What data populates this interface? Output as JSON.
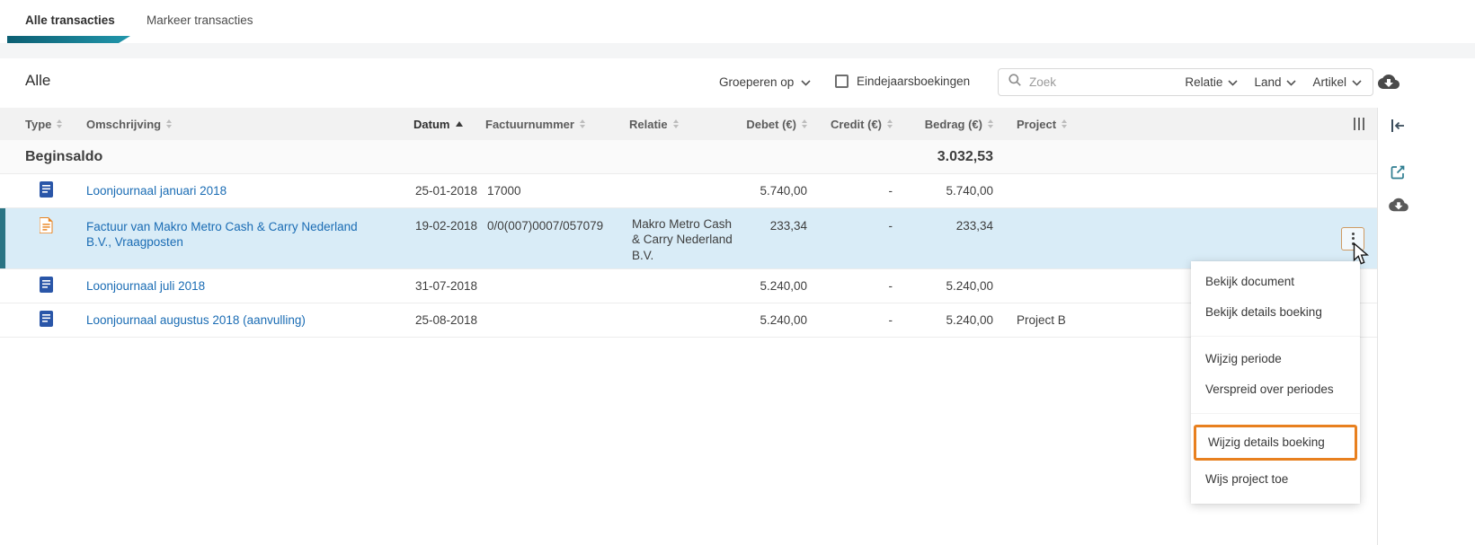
{
  "tabs": {
    "alle": "Alle transacties",
    "markeer": "Markeer transacties"
  },
  "toolbar": {
    "title": "Alle",
    "group_by": "Groeperen op",
    "year_end_label": "Eindejaarsboekingen",
    "search_placeholder": "Zoek",
    "filter_relatie": "Relatie",
    "filter_land": "Land",
    "filter_artikel": "Artikel"
  },
  "table": {
    "headers": {
      "type": "Type",
      "omschrijving": "Omschrijving",
      "datum": "Datum",
      "factuurnummer": "Factuurnummer",
      "relatie": "Relatie",
      "debet": "Debet (€)",
      "credit": "Credit (€)",
      "bedrag": "Bedrag (€)",
      "project": "Project"
    },
    "sort_column": "Datum",
    "sort_direction": "asc",
    "beginsaldo": {
      "label": "Beginsaldo",
      "bedrag": "3.032,53"
    },
    "rows": [
      {
        "icon": "journal-document",
        "omschrijving": "Loonjournaal januari 2018",
        "datum": "25-01-2018",
        "factuurnummer": "17000",
        "relatie": "",
        "debet": "5.740,00",
        "credit": "-",
        "bedrag": "5.740,00",
        "project": ""
      },
      {
        "icon": "purchase-invoice",
        "omschrijving": "Factuur van Makro Metro Cash & Carry Nederland B.V.,  Vraagposten",
        "datum": "19-02-2018",
        "factuurnummer": "0/0(007)0007/057079",
        "relatie": "Makro Metro Cash & Carry Nederland B.V.",
        "debet": "233,34",
        "credit": "-",
        "bedrag": "233,34",
        "project": "",
        "highlighted": true
      },
      {
        "icon": "journal-document",
        "omschrijving": "Loonjournaal juli 2018",
        "datum": "31-07-2018",
        "factuurnummer": "",
        "relatie": "",
        "debet": "5.240,00",
        "credit": "-",
        "bedrag": "5.240,00",
        "project": ""
      },
      {
        "icon": "journal-document",
        "omschrijving": "Loonjournaal augustus 2018 (aanvulling)",
        "datum": "25-08-2018",
        "factuurnummer": "",
        "relatie": "",
        "debet": "5.240,00",
        "credit": "-",
        "bedrag": "5.240,00",
        "project": "Project B"
      }
    ]
  },
  "context_menu": {
    "items": [
      "Bekijk document",
      "Bekijk details boeking",
      "Wijzig periode",
      "Verspreid over periodes",
      "Wijzig details boeking",
      "Wijs project toe"
    ],
    "highlighted_item": "Wijzig details boeking"
  },
  "icons": {
    "search": "magnifier",
    "chevron": "chevron-down",
    "cloud": "cloud-download",
    "kebab": "vertical-dots-menu",
    "columns": "column-settings",
    "collapse": "collapse-panel-right",
    "edit": "open-edit",
    "doc_blue": "journal-document",
    "doc_orange": "purchase-invoice"
  },
  "colors": {
    "accent_teal": "#1c7f97",
    "row_highlight": "#d9ecf7",
    "row_highlight_bar": "#2a7484",
    "link_blue": "#1a6cb4",
    "annotation_orange": "#e8801f",
    "header_gray": "#f2f2f2"
  }
}
